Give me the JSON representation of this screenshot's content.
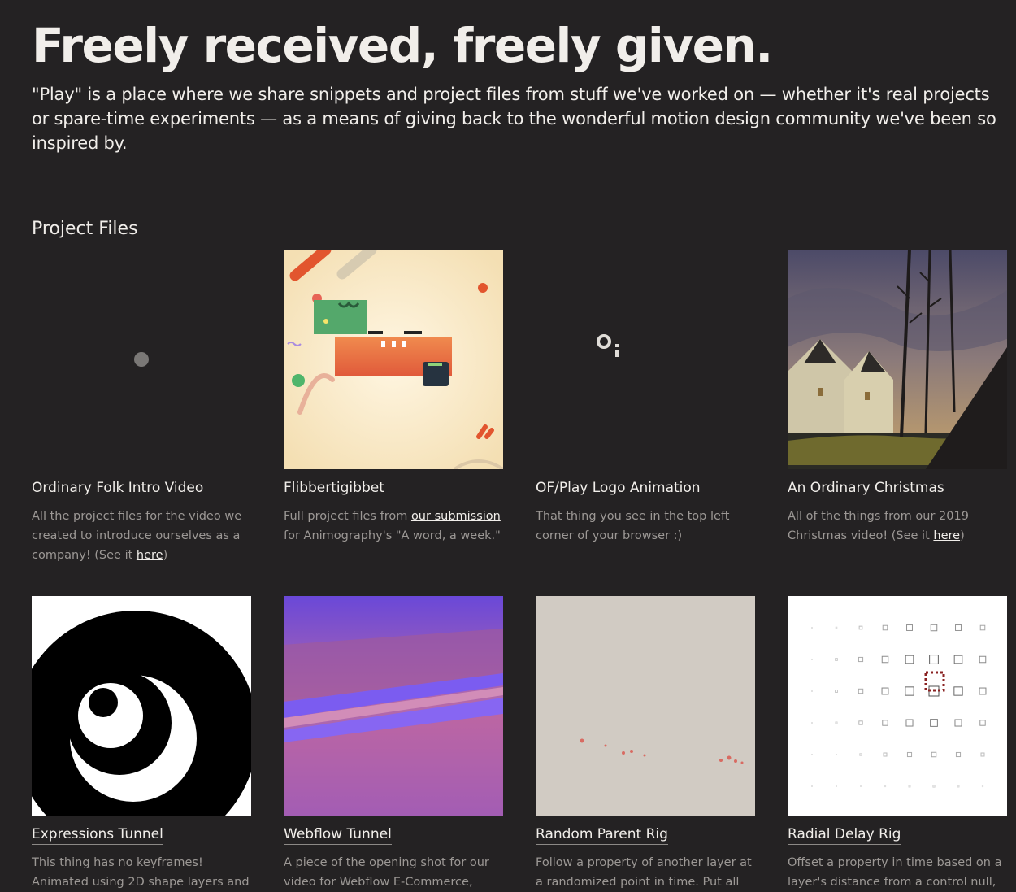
{
  "hero": {
    "title": "Freely received, freely given.",
    "intro": "\"Play\" is a place where we share snippets and project files from stuff we've worked on — whether it's real projects or spare-time experiments — as a means of giving back to the wonderful motion design community we've been so inspired by."
  },
  "section": {
    "title": "Project Files"
  },
  "cards": [
    {
      "title": "Ordinary Folk Intro Video",
      "desc_pre": "All the project files for the video we created to introduce ourselves as a company! (See it ",
      "link": "here",
      "desc_post": ")"
    },
    {
      "title": "Flibbertigibbet",
      "desc_pre": "Full project files from ",
      "link": "our submission",
      "desc_post": " for Animography's \"A word, a week.\""
    },
    {
      "title": "OF/Play Logo Animation",
      "desc": "That thing you see in the top left corner of your browser :)"
    },
    {
      "title": "An Ordinary Christmas",
      "desc_pre": "All of the things from our 2019 Christmas video! (See it ",
      "link": "here",
      "desc_post": ")"
    },
    {
      "title": "Expressions Tunnel",
      "desc": "This thing has no keyframes! Animated using 2D shape layers and"
    },
    {
      "title": "Webflow Tunnel",
      "desc": "A piece of the opening shot for our video for Webflow E-Commerce,"
    },
    {
      "title": "Random Parent Rig",
      "desc": "Follow a property of another layer at a randomized point in time. Put all"
    },
    {
      "title": "Radial Delay Rig",
      "desc": "Offset a property in time based on a layer's distance from a control null,"
    }
  ]
}
